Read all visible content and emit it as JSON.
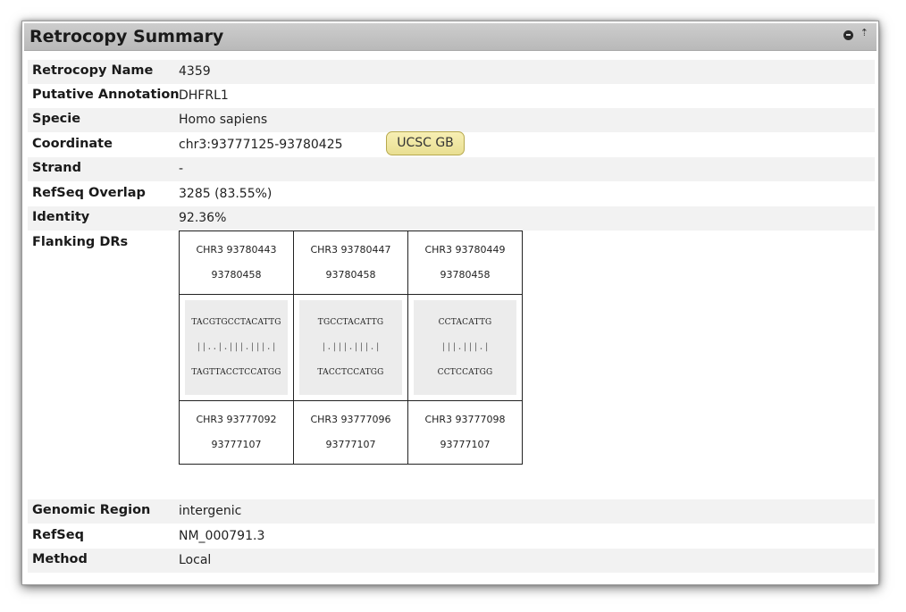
{
  "panel": {
    "title": "Retrocopy Summary"
  },
  "fields": {
    "retrocopy_name": {
      "label": "Retrocopy Name",
      "value": "4359"
    },
    "putative_annotation": {
      "label": "Putative Annotation",
      "value": "DHFRL1"
    },
    "specie": {
      "label": "Specie",
      "value": "Homo sapiens"
    },
    "coordinate": {
      "label": "Coordinate",
      "value": "chr3:93777125-93780425",
      "button": "UCSC GB"
    },
    "strand": {
      "label": "Strand",
      "value": "-"
    },
    "refseq_overlap": {
      "label": "RefSeq Overlap",
      "value": "3285 (83.55%)"
    },
    "identity": {
      "label": "Identity",
      "value": "92.36%"
    },
    "flanking_drs": {
      "label": "Flanking DRs"
    },
    "genomic_region": {
      "label": "Genomic Region",
      "value": "intergenic"
    },
    "refseq": {
      "label": "RefSeq",
      "value": "NM_000791.3"
    },
    "method": {
      "label": "Method",
      "value": "Local"
    }
  },
  "flanking_drs": [
    {
      "top_line1": "CHR3 93780443",
      "top_line2": "93780458",
      "seq1": "TACGTGCCTACATTG",
      "match": "||..|.|||.|||.|",
      "seq2": "TAGTTACCTCCATGG",
      "bottom_line1": "CHR3 93777092",
      "bottom_line2": "93777107"
    },
    {
      "top_line1": "CHR3 93780447",
      "top_line2": "93780458",
      "seq1": "TGCCTACATTG",
      "match": "|.|||.|||.|",
      "seq2": "TACCTCCATGG",
      "bottom_line1": "CHR3 93777096",
      "bottom_line2": "93777107"
    },
    {
      "top_line1": "CHR3 93780449",
      "top_line2": "93780458",
      "seq1": "CCTACATTG",
      "match": "|||.|||.|",
      "seq2": "CCTCCATGG",
      "bottom_line1": "CHR3 93777098",
      "bottom_line2": "93777107"
    }
  ]
}
